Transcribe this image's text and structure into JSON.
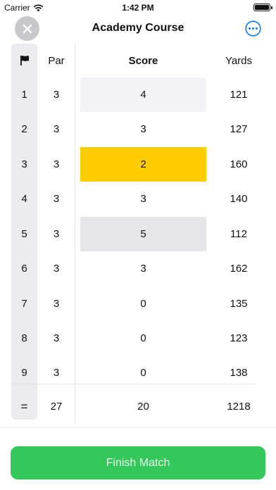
{
  "status": {
    "carrier": "Carrier",
    "time": "1:42 PM",
    "battery_level": 1.0
  },
  "nav": {
    "title": "Academy Course",
    "close_icon": "close-icon",
    "more_icon": "ellipsis-circle-icon"
  },
  "headers": {
    "flag_icon": "flag-icon",
    "par": "Par",
    "score": "Score",
    "yards": "Yards"
  },
  "colors": {
    "highlight_gold": "#ffcc00",
    "highlight_gray": "#e5e5ea",
    "highlight_light": "#f2f2f7",
    "accent_blue": "#007aff",
    "finish_green": "#34c759"
  },
  "holes": [
    {
      "hole": "1",
      "par": "3",
      "score": "4",
      "yards": "121",
      "highlight": "light"
    },
    {
      "hole": "2",
      "par": "3",
      "score": "3",
      "yards": "127",
      "highlight": "none"
    },
    {
      "hole": "3",
      "par": "3",
      "score": "2",
      "yards": "160",
      "highlight": "gold"
    },
    {
      "hole": "4",
      "par": "3",
      "score": "3",
      "yards": "140",
      "highlight": "none"
    },
    {
      "hole": "5",
      "par": "3",
      "score": "5",
      "yards": "112",
      "highlight": "gray"
    },
    {
      "hole": "6",
      "par": "3",
      "score": "3",
      "yards": "162",
      "highlight": "none"
    },
    {
      "hole": "7",
      "par": "3",
      "score": "0",
      "yards": "135",
      "highlight": "none"
    },
    {
      "hole": "8",
      "par": "3",
      "score": "0",
      "yards": "123",
      "highlight": "none"
    },
    {
      "hole": "9",
      "par": "3",
      "score": "0",
      "yards": "138",
      "highlight": "none"
    }
  ],
  "totals": {
    "symbol": "=",
    "par": "27",
    "score": "20",
    "yards": "1218"
  },
  "finish_button": "Finish Match"
}
